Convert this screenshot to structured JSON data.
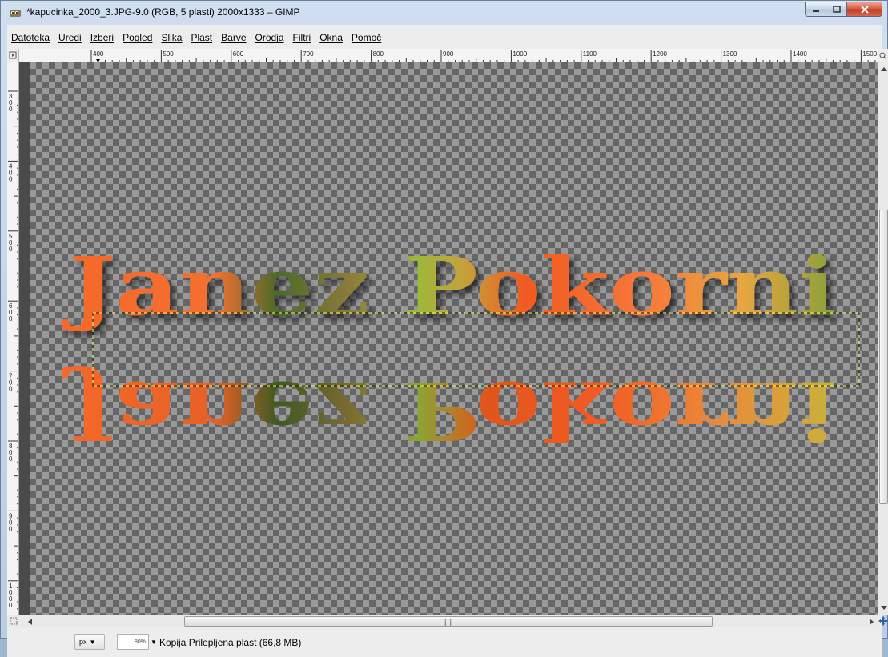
{
  "window": {
    "title": "*kapucinka_2000_3.JPG-9.0 (RGB, 5 plasti) 2000x1333 – GIMP",
    "controls": [
      "minimize",
      "maximize",
      "close"
    ]
  },
  "menu": {
    "items": [
      "Datoteka",
      "Uredi",
      "Izberi",
      "Pogled",
      "Slika",
      "Plast",
      "Barve",
      "Orodja",
      "Filtri",
      "Okna",
      "Pomoč"
    ]
  },
  "ruler": {
    "horizontal_labels": [
      "400",
      "500",
      "600",
      "700",
      "800",
      "900",
      "1000",
      "1100",
      "1200",
      "1300",
      "1400",
      "1500"
    ],
    "vertical_labels": [
      "300",
      "400",
      "500",
      "600",
      "700",
      "800",
      "900",
      "1000"
    ]
  },
  "canvas": {
    "text_top": "Janez Pokorni",
    "text_reflection": "Janez Pokorni",
    "icons": [
      "checkerboard-transparency",
      "selection-marquee"
    ]
  },
  "statusbar": {
    "unit": "px",
    "zoom": "80%",
    "layer_info": "Kopija Prilepljena plast (66,8 MB)"
  },
  "colors": {
    "accent_orange": "#f2642a",
    "text_green": "#7c9a2e",
    "checker_dark": "#666666",
    "checker_light": "#999999",
    "selection_line": "#f1f15a"
  }
}
